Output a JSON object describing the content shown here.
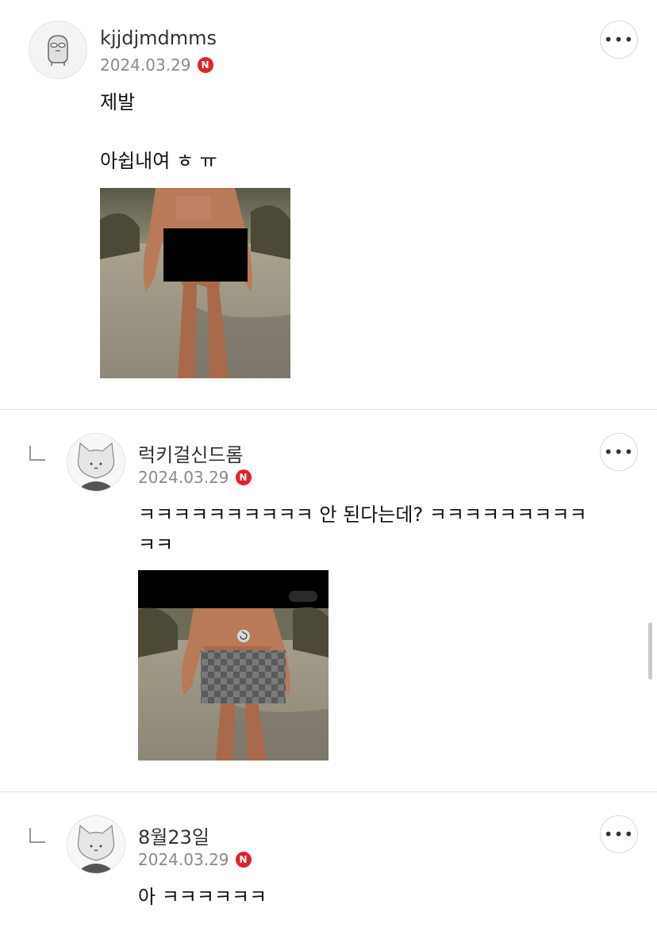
{
  "comments": [
    {
      "author": "kjjdjmdmms",
      "date": "2024.03.29",
      "badge": "N",
      "lines": [
        "제발",
        "",
        "아쉽내여 ㅎ ㅠ"
      ],
      "avatar_icon": "gray-mascot-icon",
      "has_image": true,
      "is_reply": false
    },
    {
      "author": "럭키걸신드롬",
      "date": "2024.03.29",
      "badge": "N",
      "text": "ㅋㅋㅋㅋㅋㅋㅋㅋㅋㅋ 안 된다는데? ㅋㅋㅋㅋㅋㅋㅋㅋㅋ\nㅋㅋ",
      "avatar_icon": "cat-avatar-icon",
      "has_image": true,
      "is_reply": true
    },
    {
      "author": "8월23일",
      "date": "2024.03.29",
      "badge": "N",
      "text": "아 ㅋㅋㅋㅋㅋㅋ",
      "avatar_icon": "cat-avatar-icon",
      "has_image": false,
      "is_reply": true
    }
  ],
  "more_label": "•••",
  "colors": {
    "badge": "#e4202a",
    "date": "#8a8a8a",
    "divider": "#e2e2e2"
  }
}
